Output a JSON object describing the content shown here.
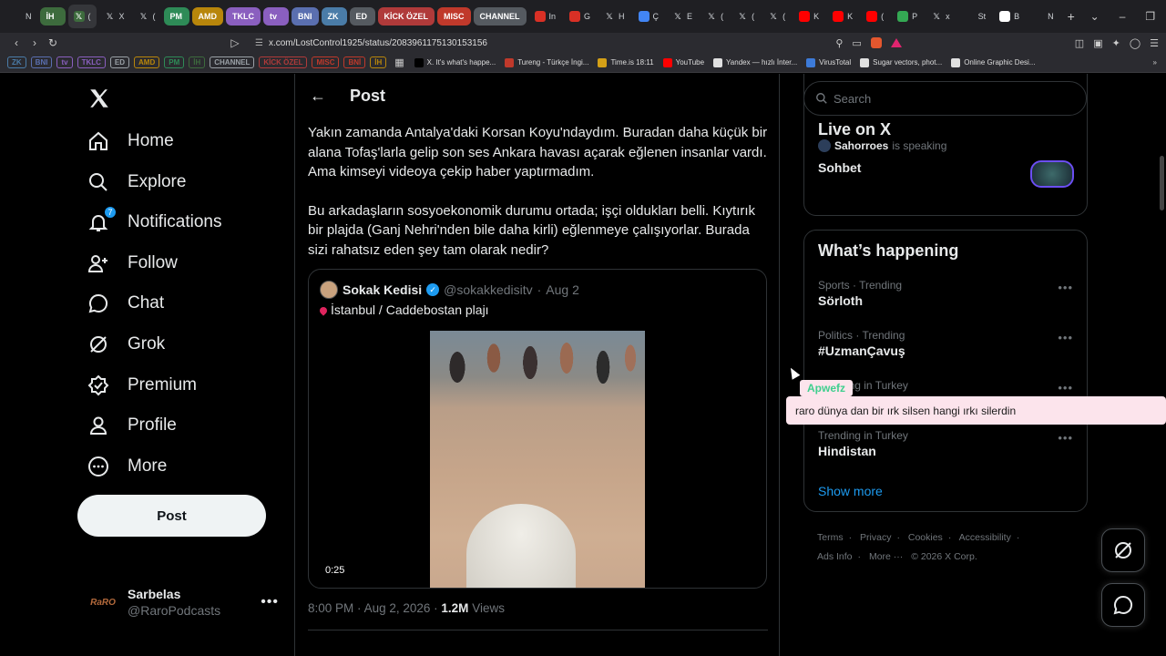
{
  "browser": {
    "tabs": [
      {
        "label": "N",
        "icon": "shield-favicon",
        "color": "#9aa0a6",
        "active": false
      },
      {
        "label": "İH",
        "group": true,
        "color": "#3d6b3d",
        "active": false
      },
      {
        "label": "(",
        "icon": "x-favicon",
        "color": "#3d6b3d",
        "active": true
      },
      {
        "label": "X",
        "icon": "x-favicon",
        "color": "#9aa0a6",
        "active": false
      },
      {
        "label": "(",
        "icon": "x-favicon",
        "color": "#9aa0a6",
        "active": false
      },
      {
        "label": "PM",
        "group": true,
        "color": "#2e8b57",
        "active": false
      },
      {
        "label": "AMD",
        "group": true,
        "color": "#b8860b",
        "active": false
      },
      {
        "label": "TKLC",
        "group": true,
        "color": "#8a5fbf",
        "active": false
      },
      {
        "label": "tv",
        "group": true,
        "color": "#8a5fbf",
        "active": false
      },
      {
        "label": "BNI",
        "group": true,
        "color": "#5a6fb0",
        "active": false
      },
      {
        "label": "ZK",
        "group": true,
        "color": "#4a7ca8",
        "active": false
      },
      {
        "label": "ED",
        "group": true,
        "color": "#555a60",
        "active": false
      },
      {
        "label": "KİCK ÖZEL",
        "group": true,
        "color": "#b03a3a",
        "active": false
      },
      {
        "label": "MISC",
        "group": true,
        "color": "#c0392b",
        "active": false
      },
      {
        "label": "CHANNEL",
        "group": true,
        "color": "#555a60",
        "active": false
      },
      {
        "label": "In",
        "icon": "gmail-favicon",
        "color": "#d93025",
        "active": false
      },
      {
        "label": "G",
        "icon": "gmail-favicon",
        "color": "#d93025",
        "active": false
      },
      {
        "label": "H",
        "icon": "x-favicon",
        "color": "#9aa0a6",
        "active": false
      },
      {
        "label": "Ç",
        "icon": "docs-favicon",
        "color": "#4285f4",
        "active": false
      },
      {
        "label": "E",
        "icon": "x-favicon",
        "color": "#9aa0a6",
        "active": false
      },
      {
        "label": "(",
        "icon": "x-favicon",
        "color": "#9aa0a6",
        "active": false
      },
      {
        "label": "(",
        "icon": "x-favicon",
        "color": "#9aa0a6",
        "active": false
      },
      {
        "label": "(",
        "icon": "x-favicon",
        "color": "#9aa0a6",
        "active": false
      },
      {
        "label": "K",
        "icon": "youtube-favicon",
        "color": "#ff0000",
        "active": false
      },
      {
        "label": "K",
        "icon": "youtube-favicon",
        "color": "#ff0000",
        "active": false
      },
      {
        "label": "(",
        "icon": "youtube-favicon",
        "color": "#ff0000",
        "active": false
      },
      {
        "label": "P",
        "icon": "drive-favicon",
        "color": "#34a853",
        "active": false
      },
      {
        "label": "x",
        "icon": "x-favicon",
        "color": "#9aa0a6",
        "active": false
      },
      {
        "label": "St",
        "icon": "settings-favicon",
        "color": "#9aa0a6",
        "active": false
      },
      {
        "label": "B",
        "icon": "diamond-favicon",
        "color": "#ffffff",
        "active": false
      },
      {
        "label": "N",
        "icon": "shield-favicon",
        "color": "#9aa0a6",
        "active": false
      }
    ],
    "new_tab": "+",
    "window_controls": {
      "menu": "⌄",
      "minimize": "–",
      "restore": "❐",
      "close": "✕"
    },
    "url": "x.com/LostControl1925/status/2083961175130153156",
    "bookmark_groups": [
      {
        "label": "ZK",
        "color": "#4a7ca8"
      },
      {
        "label": "BNI",
        "color": "#5a6fb0"
      },
      {
        "label": "tv",
        "color": "#8a5fbf"
      },
      {
        "label": "TKLC",
        "color": "#8a5fbf"
      },
      {
        "label": "ED",
        "color": "#9aa0a6"
      },
      {
        "label": "AMD",
        "color": "#b8860b"
      },
      {
        "label": "PM",
        "color": "#2e8b57"
      },
      {
        "label": "İH",
        "color": "#3d6b3d"
      },
      {
        "label": "CHANNEL",
        "color": "#9aa0a6"
      },
      {
        "label": "KİCK ÖZEL",
        "color": "#b03a3a"
      },
      {
        "label": "MISC",
        "color": "#c0392b"
      },
      {
        "label": "BNİ",
        "color": "#c0392b"
      },
      {
        "label": "İH",
        "color": "#b8860b"
      }
    ],
    "bookmarks": [
      {
        "label": "X. It's what's happe...",
        "color": "#000000"
      },
      {
        "label": "Tureng - Türkçe İngi...",
        "color": "#c0392b"
      },
      {
        "label": "Time.is 18:11",
        "color": "#d4a017"
      },
      {
        "label": "YouTube",
        "color": "#ff0000"
      },
      {
        "label": "Yandex — hızlı İnter...",
        "color": "#e0e0e0"
      },
      {
        "label": "VirusTotal",
        "color": "#3d7bd9"
      },
      {
        "label": "Sugar vectors, phot...",
        "color": "#e0e0e0"
      },
      {
        "label": "Online Graphic Desi...",
        "color": "#e0e0e0"
      }
    ]
  },
  "nav": {
    "items": [
      {
        "label": "Home",
        "icon": "home-icon"
      },
      {
        "label": "Explore",
        "icon": "search-icon"
      },
      {
        "label": "Notifications",
        "icon": "bell-icon",
        "badge": "7"
      },
      {
        "label": "Follow",
        "icon": "follow-icon"
      },
      {
        "label": "Chat",
        "icon": "chat-icon"
      },
      {
        "label": "Grok",
        "icon": "grok-icon"
      },
      {
        "label": "Premium",
        "icon": "premium-icon"
      },
      {
        "label": "Profile",
        "icon": "profile-icon"
      },
      {
        "label": "More",
        "icon": "more-icon"
      }
    ],
    "post_button": "Post",
    "account": {
      "name": "Sarbelas",
      "handle": "@RaroPodcasts",
      "avatar_text": "RaRO"
    }
  },
  "post": {
    "header_title": "Post",
    "paragraphs": [
      "Yakın zamanda Antalya'daki Korsan Koyu'ndaydım. Buradan daha küçük bir alana Tofaş'larla gelip son ses Ankara havası açarak eğlenen insanlar vardı. Ama kimseyi videoya çekip haber yaptırmadım.",
      "Bu arkadaşların sosyoekonomik durumu ortada; işçi oldukları belli. Kıytırık bir plajda (Ganj Nehri'nden bile daha kirli) eğlenmeye çalışıyorlar. Burada sizi rahatsız eden şey tam olarak nedir?"
    ],
    "quote": {
      "name": "Sokak Kedisi",
      "handle": "@sokakkedisitv",
      "date": "Aug 2",
      "text": "İstanbul / Caddebostan plajı",
      "video_duration": "0:25"
    },
    "meta": {
      "time": "8:00 PM",
      "date": "Aug 2, 2026",
      "views_count": "1.2M",
      "views_label": "Views"
    }
  },
  "sidebar": {
    "search_placeholder": "Search",
    "live": {
      "title": "Live on X",
      "speaker": "Sahorroes",
      "speaking_text": "is speaking",
      "space_title": "Sohbet"
    },
    "happening": {
      "title": "What’s happening",
      "trends": [
        {
          "category": "Sports · Trending",
          "name": "Sörloth"
        },
        {
          "category": "Politics · Trending",
          "name": "#UzmanÇavuş"
        },
        {
          "category": "Trending in Turkey",
          "name": ""
        },
        {
          "category": "Trending in Turkey",
          "name": "Hindistan"
        }
      ],
      "show_more": "Show more"
    },
    "footer": [
      "Terms",
      "Privacy",
      "Cookies",
      "Accessibility",
      "Ads Info",
      "More ···",
      "© 2026 X Corp."
    ]
  },
  "overlay": {
    "name": "Apwefz",
    "message": "raro dünya dan bir ırk silsen hangi ırkı silerdin"
  },
  "colors": {
    "accent": "#1d9bf0",
    "text": "#e7e9ea",
    "muted": "#71767b",
    "border": "#2f3336"
  }
}
